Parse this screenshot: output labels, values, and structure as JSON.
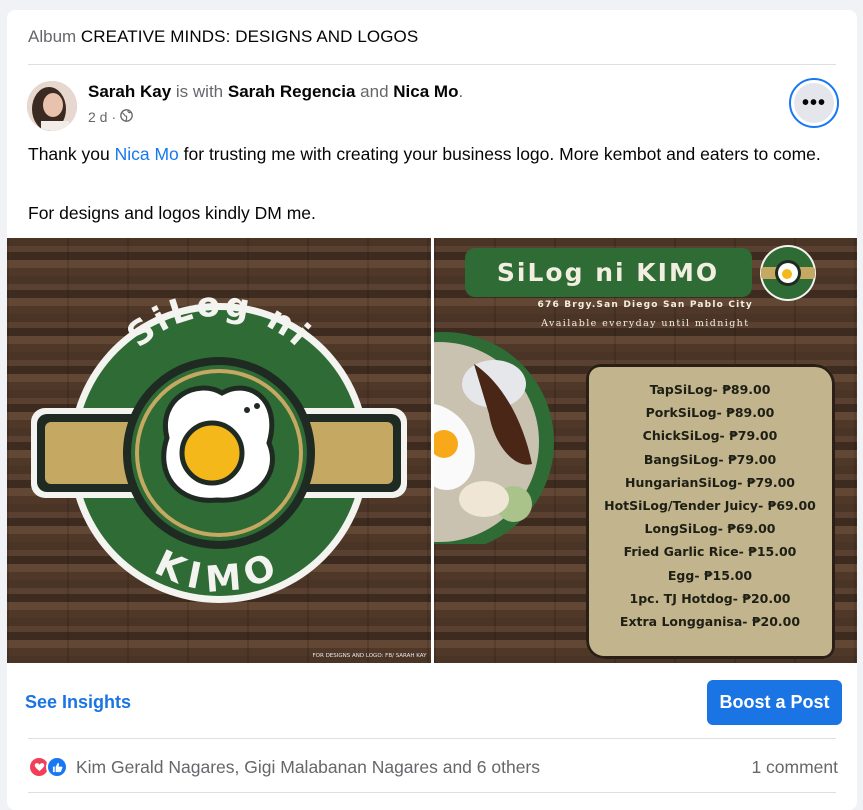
{
  "album": {
    "prefix": "Album",
    "name": "CREATIVE MINDS: DESIGNS AND LOGOS"
  },
  "post": {
    "author": "Sarah Kay",
    "with_text": "is with",
    "tagged1": "Sarah Regencia",
    "and_text": "and",
    "tagged2": "Nica Mo",
    "period": ".",
    "time": "2 d",
    "sep": "·",
    "line1_pre": "Thank you",
    "line1_link": "Nica Mo",
    "line1_post": "for trusting me with creating your business logo. More kembot and eaters to come.",
    "line2": "For designs and logos kindly DM me."
  },
  "logo": {
    "top": "SiLog ni",
    "bottom": "KIMO",
    "credit": "FOR DESIGNS AND LOGO: FB/ SARAH KAY"
  },
  "menu": {
    "title": "SiLog ni KIMO",
    "badge_top": "SiLog ni",
    "badge_bottom": "KIMO",
    "address": "676 Brgy.San Diego San Pablo City",
    "hours": "Available everyday until midnight",
    "items": [
      "TapSiLog- ₱89.00",
      "PorkSiLog- ₱89.00",
      "ChickSiLog- ₱79.00",
      "BangSiLog- ₱79.00",
      "HungarianSiLog- ₱79.00",
      "HotSiLog/Tender Juicy- ₱69.00",
      "LongSiLog- ₱69.00",
      "Fried Garlic Rice- ₱15.00",
      "Egg- ₱15.00",
      "1pc. TJ Hotdog- ₱20.00",
      "Extra Longganisa- ₱20.00"
    ]
  },
  "actions": {
    "insights": "See Insights",
    "boost": "Boost a Post"
  },
  "footer": {
    "reactors": "Kim Gerald Nagares, Gigi Malabanan Nagares and 6 others",
    "comments": "1 comment"
  },
  "icons": {
    "more": "more-options-icon",
    "globe": "globe-icon",
    "love": "love-reaction-icon",
    "like": "like-reaction-icon"
  },
  "colors": {
    "accent": "#1877f2",
    "logo_green": "#2e6b35",
    "logo_gold": "#c5a862"
  }
}
